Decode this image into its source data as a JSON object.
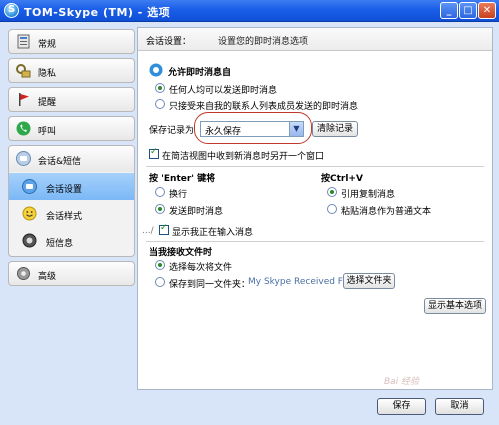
{
  "window": {
    "title": "TOM-Skype (TM) - 选项",
    "minimize": "_",
    "maximize": "□",
    "close": "✕"
  },
  "sidebar": {
    "items": [
      {
        "label": "常规",
        "icon": "general-icon"
      },
      {
        "label": "隐私",
        "icon": "privacy-lock-icon"
      },
      {
        "label": "提醒",
        "icon": "flag-icon"
      },
      {
        "label": "呼叫",
        "icon": "phone-icon"
      },
      {
        "label": "会话&短信",
        "icon": "chat-icon"
      },
      {
        "label": "会话设置",
        "icon": "chat-settings-icon"
      },
      {
        "label": "会话样式",
        "icon": "smiley-icon"
      },
      {
        "label": "短信息",
        "icon": "sms-icon"
      },
      {
        "label": "高级",
        "icon": "gear-icon"
      }
    ]
  },
  "main": {
    "header_label": "会话设置：",
    "header_desc": "设置您的即时消息选项",
    "allow_title": "允许即时消息自",
    "allow_options": [
      "任何人均可以发送即时消息",
      "只接受来自我的联系人列表成员发送的即时消息"
    ],
    "save_history_label": "保存记录为",
    "save_history_value": "永久保存",
    "clear_history_button": "清除记录",
    "new_window_check": "在简洁视图中收到新消息时另开一个窗口",
    "enter_title": "按 'Enter' 键将",
    "enter_options": [
      "换行",
      "发送即时消息"
    ],
    "ctrlv_title": "按Ctrl+V",
    "ctrlv_options": [
      "引用复制消息",
      "粘贴消息作为普通文本"
    ],
    "typing_check": "显示我正在输入消息",
    "file_title": "当我接收文件时",
    "file_options": [
      "选择每次将文件",
      "保存到同一文件夹："
    ],
    "file_folder": "My Skype Received Files",
    "choose_folder_button": "选择文件夹",
    "show_basic_button": "显示基本选项",
    "typing_marker": ".../"
  },
  "footer": {
    "save": "保存",
    "cancel": "取消"
  },
  "watermark": "Bai 经验"
}
